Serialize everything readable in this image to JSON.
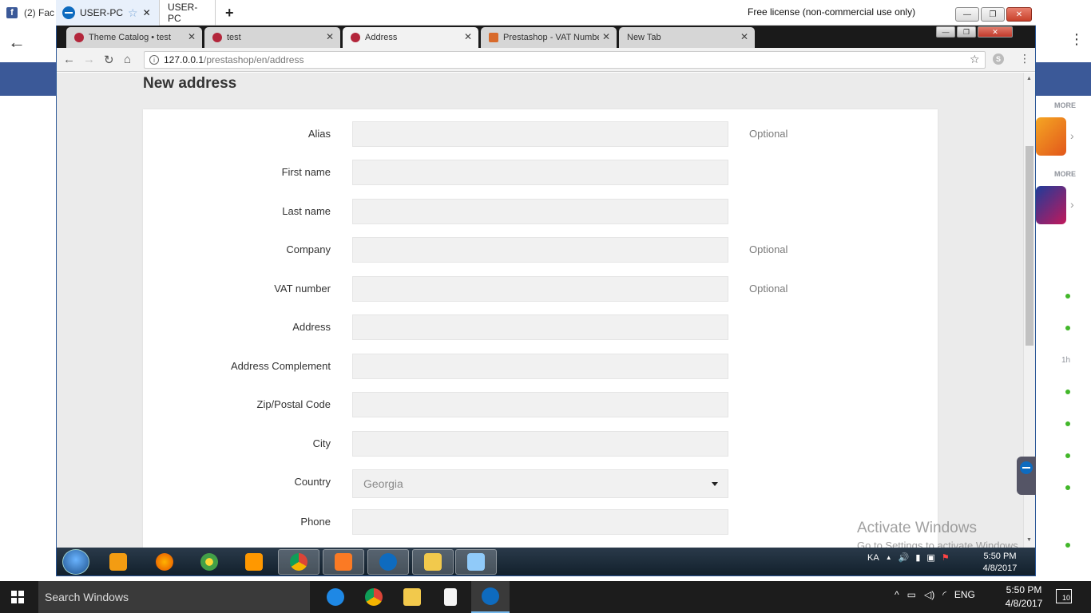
{
  "host_browser": {
    "tab_title": "(2) Fac",
    "menu_glyph": "⋮"
  },
  "facebook_sidebar": {
    "more_label_1": "MORE",
    "more_label_2": "MORE",
    "time_label": "1h",
    "chevron": "›"
  },
  "teamviewer": {
    "tabs": [
      {
        "label": "USER-PC",
        "star": "☆",
        "close": "✕"
      },
      {
        "label": "USER-PC"
      }
    ],
    "new_tab_glyph": "+",
    "license_text": "Free license (non-commercial use only)",
    "window_buttons": {
      "minimize": "—",
      "restore": "❐",
      "close": "✕"
    }
  },
  "chrome": {
    "tabs": [
      {
        "title": "Theme Catalog • test",
        "close": "✕",
        "active": false
      },
      {
        "title": "test",
        "close": "✕",
        "active": false
      },
      {
        "title": "Address",
        "close": "✕",
        "active": true
      },
      {
        "title": "Prestashop - VAT Numbe",
        "close": "✕",
        "active": false
      },
      {
        "title": "New Tab",
        "close": "✕",
        "active": false
      }
    ],
    "window_buttons": {
      "minimize": "—",
      "restore": "❐",
      "close": "✕"
    },
    "nav": {
      "back": "←",
      "forward": "→",
      "reload": "↻",
      "home": "⌂"
    },
    "address_bar": {
      "host": "127.0.0.1",
      "path": "/prestashop/en/address",
      "info_glyph": "i"
    },
    "star_glyph": "☆",
    "skype_glyph": "S",
    "menu_glyph": "⋮"
  },
  "page": {
    "title": "New address",
    "fields": [
      {
        "label": "Alias",
        "value": "",
        "hint": "Optional"
      },
      {
        "label": "First name",
        "value": "",
        "hint": ""
      },
      {
        "label": "Last name",
        "value": "",
        "hint": ""
      },
      {
        "label": "Company",
        "value": "",
        "hint": "Optional"
      },
      {
        "label": "VAT number",
        "value": "",
        "hint": "Optional"
      },
      {
        "label": "Address",
        "value": "",
        "hint": ""
      },
      {
        "label": "Address Complement",
        "value": "",
        "hint": ""
      },
      {
        "label": "Zip/Postal Code",
        "value": "",
        "hint": ""
      },
      {
        "label": "City",
        "value": "",
        "hint": ""
      }
    ],
    "country": {
      "label": "Country",
      "selected": "Georgia"
    },
    "phone": {
      "label": "Phone",
      "value": ""
    }
  },
  "watermark": {
    "title": "Activate Windows",
    "subtitle": "Go to Settings to activate Windows."
  },
  "remote_taskbar": {
    "tray": {
      "language": "KA",
      "arrow": "▲",
      "volume": "🔊"
    },
    "clock": {
      "time": "5:50 PM",
      "date": "4/8/2017"
    }
  },
  "host_taskbar": {
    "search_placeholder": "Search Windows",
    "tray": {
      "arrow": "^",
      "language": "ENG"
    },
    "clock": {
      "time": "5:50 PM",
      "date": "4/8/2017"
    },
    "notification_count": "10"
  },
  "colors": {
    "facebook_blue": "#3b5998",
    "page_background": "#ebebeb",
    "input_fill": "#f1f1f1",
    "teamviewer_blue": "#0e6bbf"
  }
}
